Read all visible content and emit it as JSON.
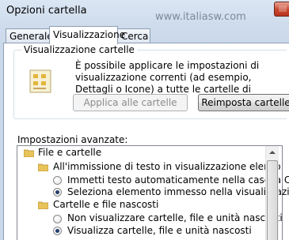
{
  "window": {
    "title": "Opzioni cartella",
    "watermark": "www.italiasw.com"
  },
  "tabs": [
    {
      "label": "Generale",
      "active": false
    },
    {
      "label": "Visualizzazione",
      "active": true
    },
    {
      "label": "Cerca",
      "active": false
    }
  ],
  "view_group": {
    "title": "Visualizzazione cartelle",
    "description": "È possibile applicare le impostazioni di visualizzazione correnti (ad esempio, Dettagli o Icone) a tutte le cartelle di questo tipo.",
    "apply_label": "Applica alle cartelle",
    "reset_label": "Reimposta cartelle"
  },
  "advanced": {
    "label": "Impostazioni avanzate:",
    "items": [
      {
        "type": "folder",
        "label": "File e cartelle"
      },
      {
        "type": "folder",
        "label": "All'immissione di testo in visualizzazione elenco"
      },
      {
        "type": "radio",
        "label": "Immetti testo automaticamente nella casella Cerca",
        "checked": false
      },
      {
        "type": "radio",
        "label": "Seleziona elemento immesso nella visualizzazione",
        "checked": true
      },
      {
        "type": "folder",
        "label": "Cartelle e file nascosti"
      },
      {
        "type": "radio",
        "label": "Non visualizzare cartelle, file e unità nascosti",
        "checked": false
      },
      {
        "type": "radio",
        "label": "Visualizza cartelle, file e unità nascosti",
        "checked": true
      }
    ]
  },
  "colors": {
    "accent": "#233c6b",
    "folder": "#e8c35a"
  }
}
